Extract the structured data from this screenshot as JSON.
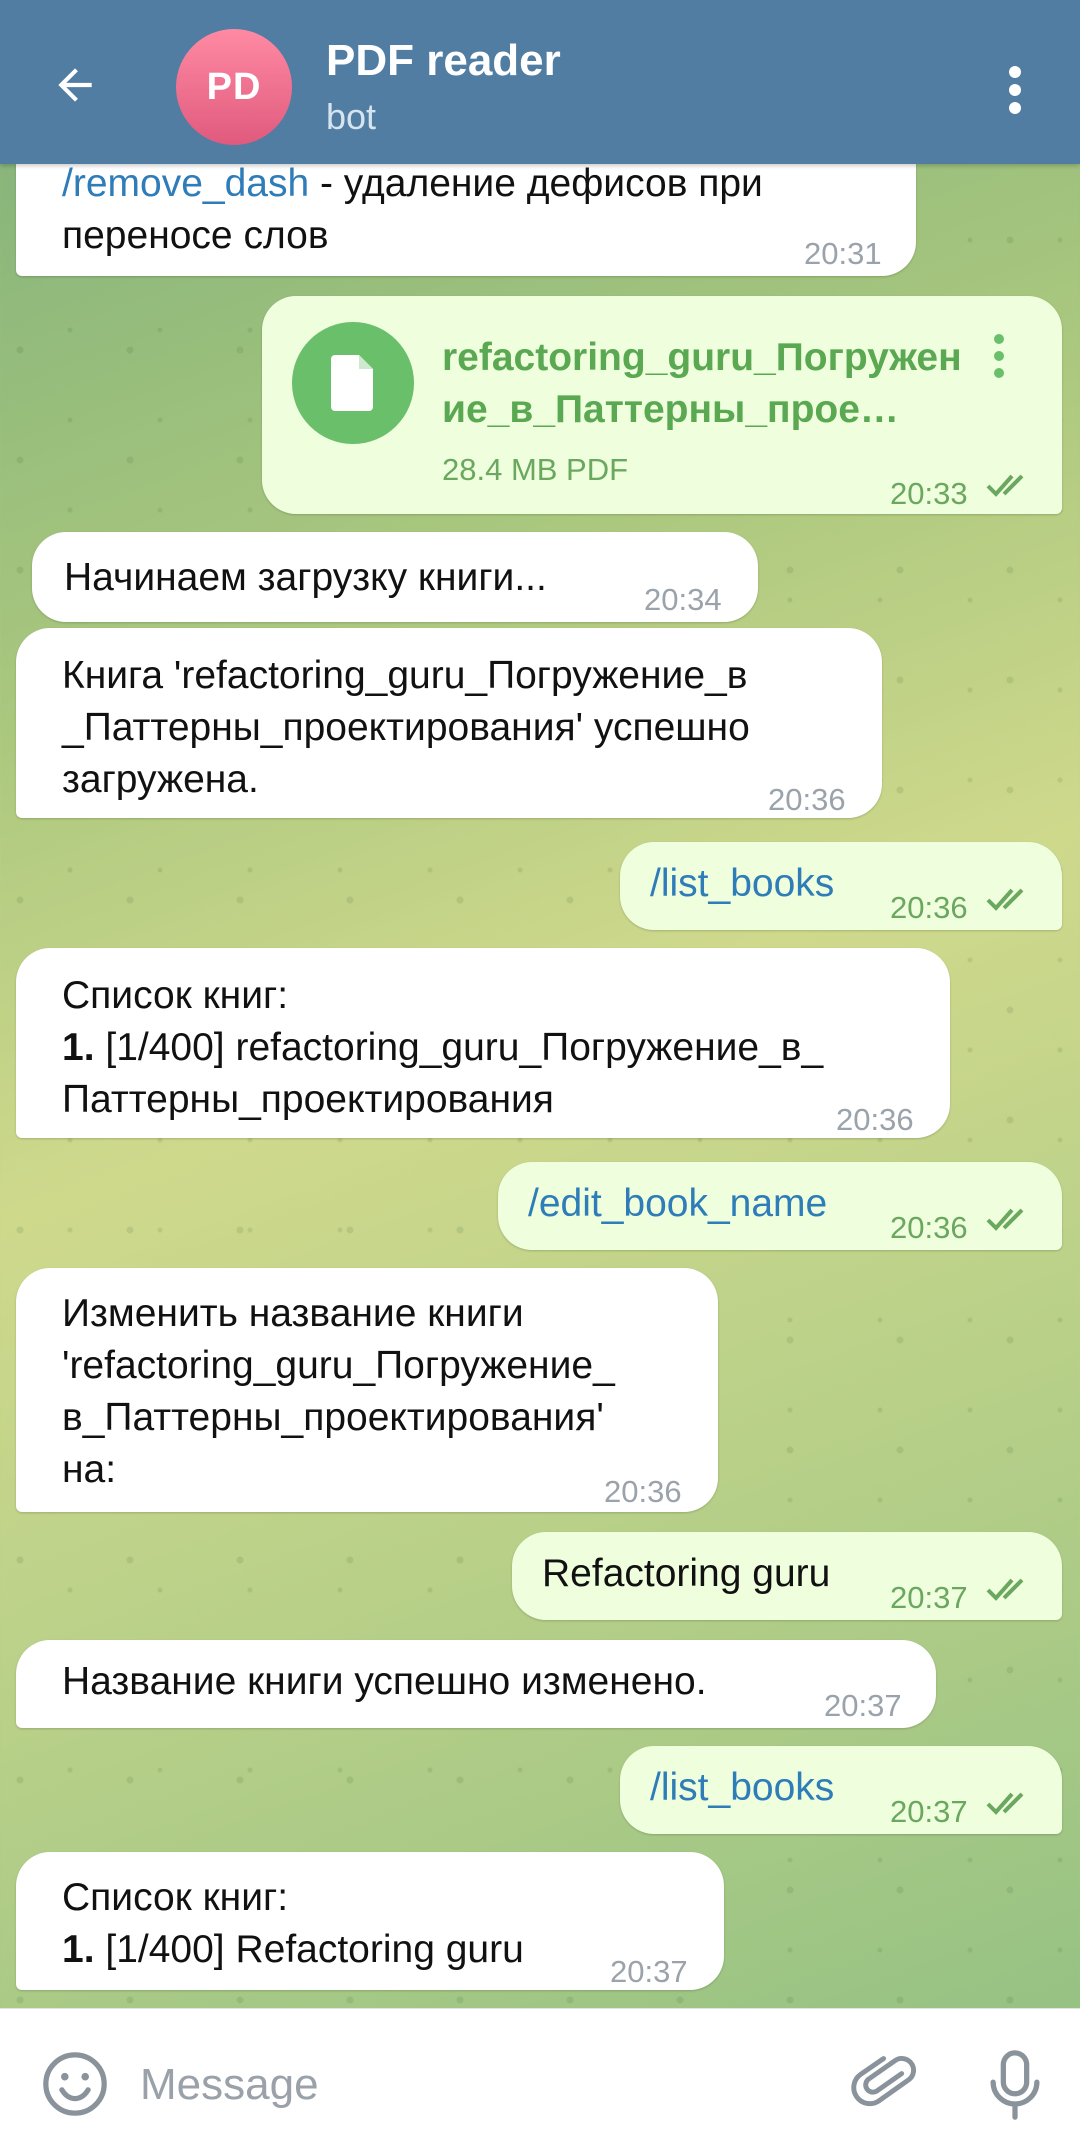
{
  "header": {
    "back_icon": "arrow-left-icon",
    "avatar_initials": "PD",
    "title": "PDF reader",
    "subtitle": "bot",
    "menu_icon": "more-vertical-icon"
  },
  "messages": [
    {
      "dir": "in",
      "line1_cmd": "/remove_dash",
      "line1_rest": " - удаление дефисов при",
      "line2": "переносе слов",
      "time": "20:31"
    },
    {
      "dir": "out",
      "type": "file",
      "file_icon": "document-icon",
      "file_name": "refactoring_guru_Погружение_в_Паттерны_прое…",
      "file_name_line1": "refactoring_guru_Погружен",
      "file_name_line2": "ие_в_Паттерны_прое…",
      "file_size": "28.4 MB PDF",
      "time": "20:33",
      "status_icon": "double-check-icon"
    },
    {
      "dir": "in",
      "text": "Начинаем загрузку книги...",
      "time": "20:34"
    },
    {
      "dir": "in",
      "line1": "Книга 'refactoring_guru_Погружение_в",
      "line2": "_Паттерны_проектирования' успешно",
      "line3": "загружена.",
      "time": "20:36"
    },
    {
      "dir": "out",
      "text": "/list_books",
      "time": "20:36",
      "status_icon": "double-check-icon"
    },
    {
      "dir": "in",
      "line1": "Список книг:",
      "line2_num": "1.",
      "line2_rest": " [1/400] refactoring_guru_Погружение_в_",
      "line3": "Паттерны_проектирования",
      "time": "20:36"
    },
    {
      "dir": "out",
      "text": "/edit_book_name",
      "time": "20:36",
      "status_icon": "double-check-icon"
    },
    {
      "dir": "in",
      "line1": "Изменить название книги",
      "line2": "'refactoring_guru_Погружение_",
      "line3": "в_Паттерны_проектирования'",
      "line4": "на:",
      "time": "20:36"
    },
    {
      "dir": "out",
      "text": "Refactoring guru",
      "time": "20:37",
      "status_icon": "double-check-icon"
    },
    {
      "dir": "in",
      "text": "Название книги успешно изменено.",
      "time": "20:37"
    },
    {
      "dir": "out",
      "text": "/list_books",
      "time": "20:37",
      "status_icon": "double-check-icon"
    },
    {
      "dir": "in",
      "line1": "Список книг:",
      "line2_num": "1.",
      "line2_rest": " [1/400] Refactoring guru",
      "time": "20:37"
    }
  ],
  "input": {
    "placeholder": "Message",
    "value": "",
    "emoji_icon": "smile-icon",
    "attach_icon": "paperclip-icon",
    "mic_icon": "microphone-icon"
  },
  "colors": {
    "header_bg": "#517da2",
    "incoming_bubble": "#ffffff",
    "outgoing_bubble": "#effedd",
    "command_link": "#2e7cb8",
    "outgoing_time": "#6aa75f",
    "file_accent": "#6abf6a"
  }
}
